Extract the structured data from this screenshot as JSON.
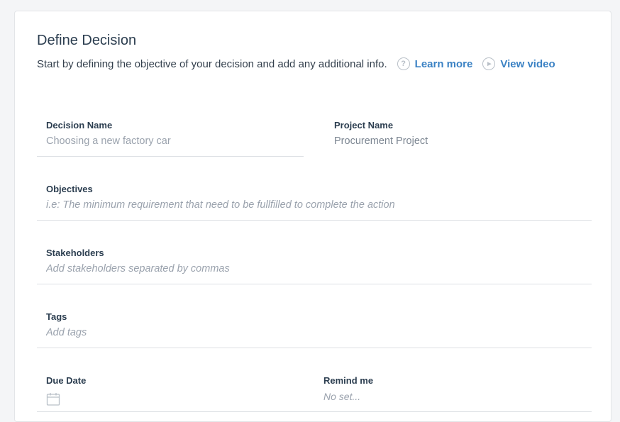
{
  "header": {
    "title": "Define Decision",
    "subtitle": "Start by defining the objective of your decision and add any additional info.",
    "learn_more_label": "Learn more",
    "learn_more_icon": "?",
    "view_video_label": "View video",
    "view_video_icon": "▶"
  },
  "fields": {
    "decision_name": {
      "label": "Decision Name",
      "placeholder": "Choosing a new factory car"
    },
    "project_name": {
      "label": "Project Name",
      "value": "Procurement Project"
    },
    "objectives": {
      "label": "Objectives",
      "placeholder": "i.e: The minimum requirement that need to be fullfilled to complete the action"
    },
    "stakeholders": {
      "label": "Stakeholders",
      "placeholder": "Add stakeholders separated by commas"
    },
    "tags": {
      "label": "Tags",
      "placeholder": "Add tags"
    },
    "due_date": {
      "label": "Due Date",
      "icon": "calendar-icon"
    },
    "remind_me": {
      "label": "Remind me",
      "value": "No set..."
    }
  },
  "colors": {
    "accent_link": "#3b82c4",
    "label_text": "#2c3e50",
    "placeholder_text": "#9aa2ad",
    "divider": "#dde0e4"
  }
}
